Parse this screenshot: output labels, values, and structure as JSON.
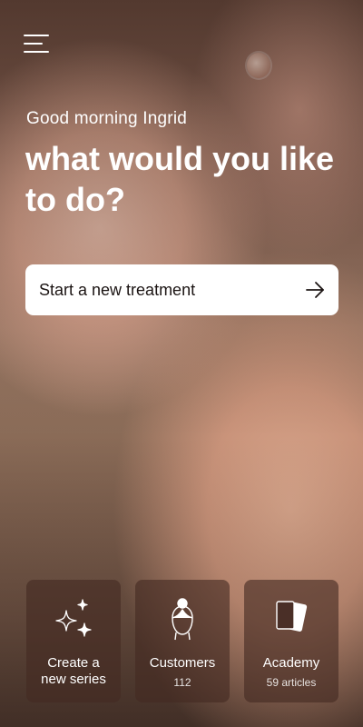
{
  "header": {
    "menu_icon": "hamburger-menu-icon",
    "greeting": "Good morning Ingrid",
    "headline": "what would you like to do?"
  },
  "cta": {
    "label": "Start a new treatment",
    "icon": "arrow-right-icon"
  },
  "tiles": [
    {
      "icon": "sparkles-icon",
      "label_line1": "Create a",
      "label_line2": "new series",
      "sub": ""
    },
    {
      "icon": "customer-head-icon",
      "label_line1": "Customers",
      "label_line2": "",
      "sub": "112"
    },
    {
      "icon": "cards-icon",
      "label_line1": "Academy",
      "label_line2": "",
      "sub": "59 articles"
    }
  ],
  "colors": {
    "text_light": "#ffffff",
    "text_dark": "#1b1413",
    "tile_bg": "#442a22",
    "cta_bg": "#ffffff"
  }
}
